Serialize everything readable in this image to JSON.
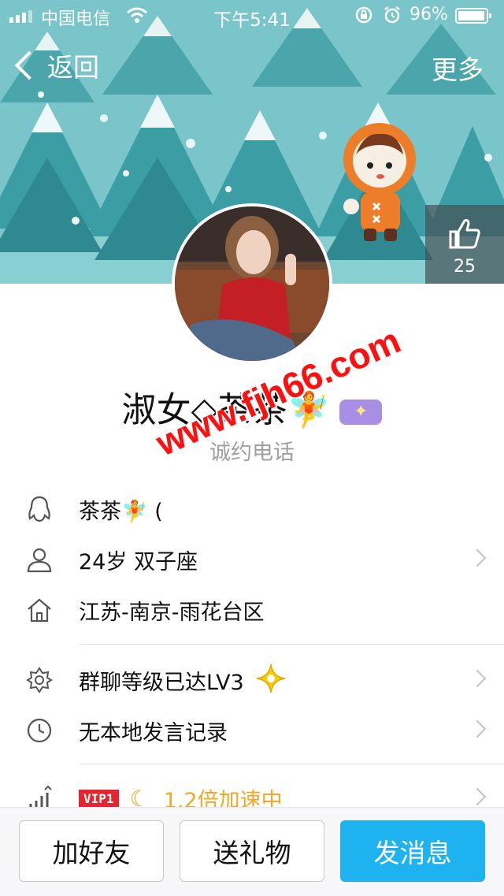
{
  "status_bar": {
    "carrier": "中国电信",
    "time": "下午5:41",
    "battery": "96%"
  },
  "nav": {
    "back_label": "返回",
    "more_label": "更多"
  },
  "likes": {
    "count": "25"
  },
  "profile": {
    "name": "淑女◇茶茶🧚",
    "subtitle": "诚约电话",
    "watermark": "www.fjh66.com"
  },
  "info": {
    "qq_nickname": "茶茶🧚 (",
    "age_sign": "24岁 双子座",
    "location": "江苏-南京-雨花台区",
    "group_level": "群聊等级已达LV3",
    "speech_record": "无本地发言记录",
    "vip_tag": "VIP1",
    "vip_speed": "1.2倍加速中"
  },
  "actions": {
    "add_friend": "加好友",
    "send_gift": "送礼物",
    "send_message": "发消息"
  },
  "colors": {
    "banner": "#78c4c8",
    "primary_button": "#1fb2f0",
    "vip_orange": "#f5a623",
    "vip_red": "#e4242f"
  }
}
